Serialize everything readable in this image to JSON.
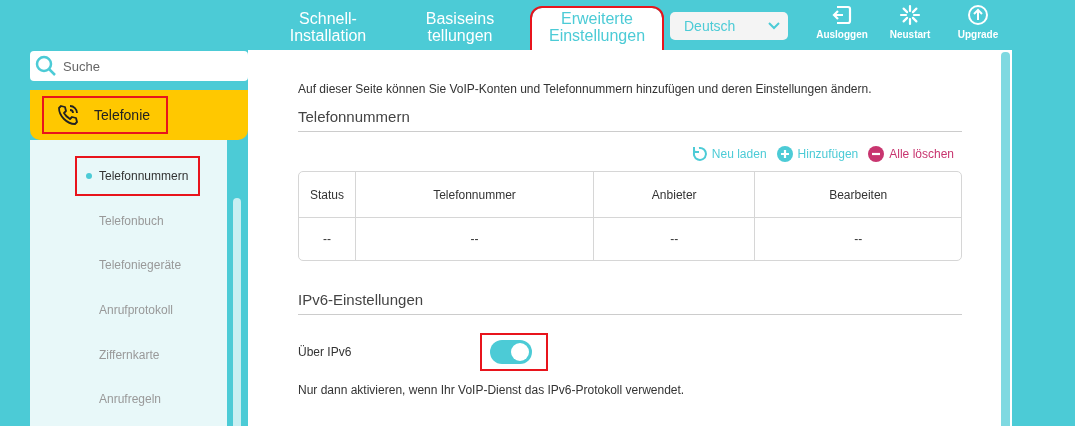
{
  "top_tabs": [
    {
      "label": "Schnell-\nInstallation",
      "selected": false,
      "highlighted": false
    },
    {
      "label": "Basiseins\ntellungen",
      "selected": false,
      "highlighted": false
    },
    {
      "label": "Erweiterte\nEinstellungen",
      "selected": true,
      "highlighted": true
    }
  ],
  "language": {
    "value": "Deutsch"
  },
  "top_actions": [
    {
      "kind": "logout",
      "label": "Ausloggen"
    },
    {
      "kind": "reboot",
      "label": "Neustart"
    },
    {
      "kind": "upgrade",
      "label": "Upgrade"
    }
  ],
  "search": {
    "placeholder": "Suche"
  },
  "menu_section": {
    "label": "Telefonie",
    "highlighted": true
  },
  "sub_items": [
    {
      "label": "Telefonnummern",
      "selected": true,
      "highlighted": true
    },
    {
      "label": "Telefonbuch",
      "selected": false,
      "highlighted": false
    },
    {
      "label": "Telefoniegeräte",
      "selected": false,
      "highlighted": false
    },
    {
      "label": "Anrufprotokoll",
      "selected": false,
      "highlighted": false
    },
    {
      "label": "Ziffernkarte",
      "selected": false,
      "highlighted": false
    },
    {
      "label": "Anrufregeln",
      "selected": false,
      "highlighted": false
    }
  ],
  "intro": "Auf dieser Seite können Sie VoIP-Konten und Telefonnummern hinzufügen und deren Einstellungen ändern.",
  "numbers_section": {
    "title": "Telefonnummern",
    "actions": [
      {
        "kind": "reload",
        "label": "Neu laden"
      },
      {
        "kind": "add",
        "label": "Hinzufügen"
      },
      {
        "kind": "delete",
        "label": "Alle löschen"
      }
    ],
    "table": {
      "columns": [
        "Status",
        "Telefonnummer",
        "Anbieter",
        "Bearbeiten"
      ],
      "rows": [
        [
          "--",
          "--",
          "--",
          "--"
        ]
      ]
    }
  },
  "ipv6_section": {
    "title": "IPv6-Einstellungen",
    "label": "Über IPv6",
    "on": true,
    "highlighted": true,
    "note": "Nur dann aktivieren, wenn Ihr VoIP-Dienst das IPv6-Protokoll verwendet."
  }
}
